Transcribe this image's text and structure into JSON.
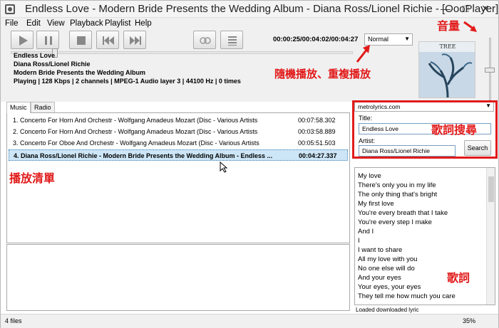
{
  "window": {
    "title": "Endless Love - Modern Bride Presents the Wedding Album - Diana Ross/Lionel Richie - [OooPlayer]"
  },
  "menu": [
    "File",
    "Edit",
    "View",
    "Playback",
    "Playlist",
    "Help"
  ],
  "controls": {
    "play": "play-icon",
    "stop": "stop-icon",
    "prev": "previous-icon",
    "next": "next-icon",
    "shuffle": "shuffle-icon",
    "list": "list-icon",
    "time": "00:00:25/00:04:02/00:04:27",
    "mode": "Normal",
    "seek_fraction": 0.14,
    "volume_fraction": 0.5
  },
  "nowplaying": {
    "title": "Endless Love",
    "artist": "Diana Ross/Lionel Richie",
    "album": "Modern Bride Presents the Wedding Album",
    "status": "Playing | 128 Kbps | 2 channels | MPEG-1 Audio layer 3 | 44100 Hz | 0 times"
  },
  "cover": {
    "text": "TREE"
  },
  "tabs": [
    "Music",
    "Radio"
  ],
  "playlist": [
    {
      "title": "1. Concerto For Horn And Orchestr - Wolfgang Amadeus Mozart (Disc - Various Artists",
      "duration": "00:07:58.302"
    },
    {
      "title": "2. Concerto For Horn And Orchestr - Wolfgang Amadeus Mozart (Disc - Various Artists",
      "duration": "00:03:58.889"
    },
    {
      "title": "3. Concerto For Oboe And Orchestr - Wolfgang Amadeus Mozart (Disc - Various Artists",
      "duration": "00:05:51.503"
    },
    {
      "title": "4. Diana Ross/Lionel Richie - Modern Bride Presents the Wedding Album - Endless ...",
      "duration": "00:04:27.337"
    }
  ],
  "lyricsearch": {
    "site": "metrolyrics.com",
    "title_label": "Title:",
    "title_value": "Endless Love",
    "artist_label": "Artist:",
    "artist_value": "Diana Ross/Lionel Richie",
    "search_label": "Search"
  },
  "lyrics": [
    "My love",
    "There's only you in my life",
    "The only thing that's bright",
    "My first love",
    "You're every breath that I take",
    "You're every step I make",
    "And I",
    "I",
    "I want to share",
    "All my love with you",
    "No one else will do",
    "And your eyes",
    "Your eyes, your eyes",
    "They tell me how much you care"
  ],
  "lyrics_status": "Loaded downloaded lyric",
  "status": {
    "files": "4 files",
    "volume": "35%"
  },
  "annotations": {
    "volume": "音量",
    "mode": "隨機播放、重複播放",
    "playlist": "播放清單",
    "lyric_search": "歌詞搜尋",
    "lyrics": "歌詞"
  },
  "colors": {
    "annotation": "#e21a1a",
    "selection": "#cde6f7"
  }
}
